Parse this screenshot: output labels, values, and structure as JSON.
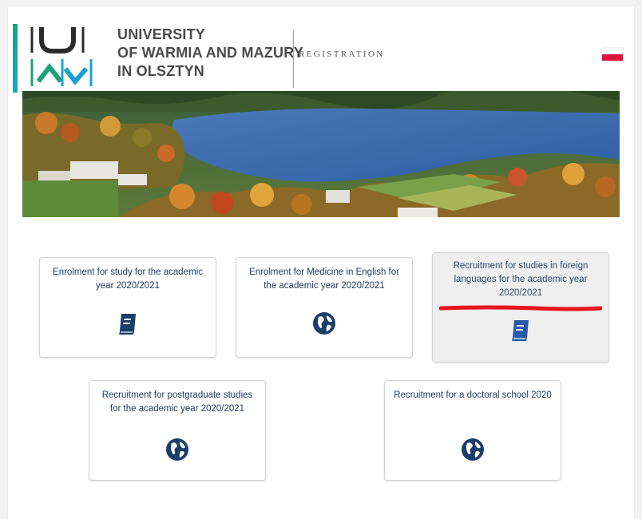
{
  "colors": {
    "accent_green": "#1aa37a",
    "accent_teal": "#1aa3c8",
    "logo_dark": "#2b2b2b",
    "logo_green": "#1aa37a",
    "logo_blue": "#1ba0d8",
    "uni_name": "#4a4a4a",
    "tile_text": "#1f3b63",
    "icon": "#1a3d6b",
    "annotation_red": "#e8141e"
  },
  "header": {
    "university_name": {
      "line1": "UNIVERSITY",
      "line2": "OF WARMIA AND MAZURY",
      "line3": "IN OLSZTYN"
    },
    "section": "REGISTRATION",
    "language_flag": "Polish flag"
  },
  "banner": {
    "description": "aerial-lake-campus-photo"
  },
  "tiles": [
    {
      "label": "Enrolment for study for the academic year 2020/2021",
      "icon": "book-icon"
    },
    {
      "label": "Enrolment for Medicine in English for the academic year 2020/2021",
      "icon": "globe-icon"
    },
    {
      "label": "Recruitment for studies in foreign languages for the academic year 2020/2021",
      "icon": "book-icon"
    },
    {
      "label": "Recruitment for postgraduate studies for the academic year 2020/2021",
      "icon": "globe-icon"
    },
    {
      "label": "Recruitment for a doctoral school 2020",
      "icon": "globe-icon"
    }
  ]
}
